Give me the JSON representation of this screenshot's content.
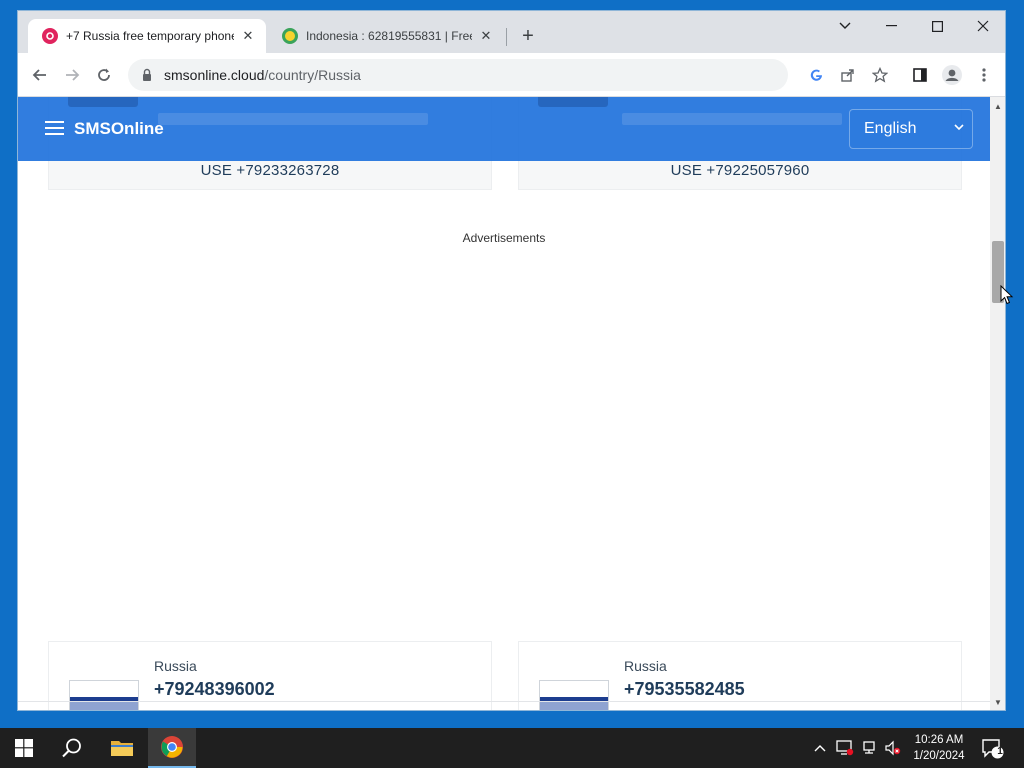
{
  "browser": {
    "tabs": [
      {
        "title": "+7 Russia free temporary phone",
        "favicon": "smsonline-red-circle-icon",
        "active": true
      },
      {
        "title": "Indonesia : 62819555831 | Free",
        "favicon": "green-yellow-circle-icon",
        "active": false
      }
    ],
    "address": {
      "host": "smsonline.cloud",
      "path": "/country/Russia"
    }
  },
  "site": {
    "brand": "SMSOnline",
    "language": "English",
    "top_cards": [
      {
        "use_label": "USE +79233263728"
      },
      {
        "use_label": "USE +79225057960"
      }
    ],
    "ads_label": "Advertisements",
    "bottom_cards": [
      {
        "country": "Russia",
        "number": "+79248396002"
      },
      {
        "country": "Russia",
        "number": "+79535582485"
      }
    ]
  },
  "taskbar": {
    "time": "10:26 AM",
    "date": "1/20/2024",
    "notification_count": "1"
  },
  "colors": {
    "header_blue": "#1f72dc",
    "desktop_blue": "#0f6fc6",
    "taskbar": "#1f1f1f"
  }
}
